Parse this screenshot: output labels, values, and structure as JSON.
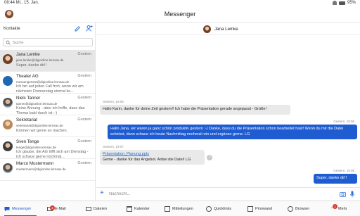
{
  "statusbar": {
    "time": "08:44 Mi., 15. Jan.",
    "battery": "95%"
  },
  "app": {
    "title": "Messenger"
  },
  "contacts_panel": {
    "label": "Kontakte",
    "search_placeholder": "Suche",
    "items": [
      {
        "name": "Jana Lemke",
        "time": "Gestern",
        "email": "jana.lemke@digionline.lernsax.de",
        "preview": "Super, danke dir!!",
        "active": true
      },
      {
        "name": "Theater AG",
        "time": "Gestern",
        "email": "messengertest@digionline.lernsax.de",
        "preview": "Ich bin auf jeden Fall froh, wenn wir am nächsten Donnerstag einmal ko..."
      },
      {
        "name": "Niels Tanner",
        "time": "Gestern",
        "email": "tanner@digionline.lernsax.de",
        "preview": "Keine Ahnung - aber ich hoffe, dass das Thema bald durch ist :-)"
      },
      {
        "name": "Sekretariat",
        "time": "Gestern",
        "email": "sekretariat@digionline.lernsax.de",
        "preview": "Können wir gerne so machen."
      },
      {
        "name": "Sven Tenge",
        "time": "Gestern",
        "email": "tenge@digionline.lernsax.de",
        "preview": "Ich glaube, die AG trifft sich am Dienstag - ich schaue gerne nochmal..."
      },
      {
        "name": "Marco Mustermann",
        "time": "Gestern",
        "email": "mustermann@digionline.lernsax.de",
        "preview": ""
      }
    ]
  },
  "chat": {
    "partner": "Jana Lemke",
    "messages": [
      {
        "direction": "in",
        "time": "Gestern, 19:05",
        "text": "Hallo Karin, danke für deine Zeit gestern!! Ich habe die Präsentation gerade angepasst - Grüße!"
      },
      {
        "direction": "out",
        "time": "Gestern, 19:06",
        "text": "Hallo Jana, wir waren ja ganz schön produktiv gestern :-) Danke, dass du die Präsentation schon bearbeitet hast! Wenn du mir die Datei schickst, dann schaue ich heute Nachmittag nochmal rein und ergänze gerne. LG"
      },
      {
        "direction": "in",
        "time": "Gestern, 19:07",
        "attachment": "Präsentation_Planung.pptx",
        "text": "Geme - danke für das Angebot. Anbei die Datei! LG"
      },
      {
        "direction": "out",
        "time": "Gestern, 19:08",
        "text": "Super, danke dir!!"
      }
    ],
    "input_placeholder": "Nachricht..."
  },
  "bottomnav": [
    {
      "label": "Messenger",
      "active": true
    },
    {
      "label": "E-Mail",
      "badge": "2"
    },
    {
      "label": "Dateien"
    },
    {
      "label": "Kalender"
    },
    {
      "label": "Mitteilungen"
    },
    {
      "label": "Quicklinks"
    },
    {
      "label": "Pinnwand"
    },
    {
      "label": "Browser"
    },
    {
      "label": "Mehr",
      "badge": "1"
    }
  ],
  "colors": {
    "accent": "#1f5bd1",
    "badge": "#d83b2e",
    "outgoing_bubble": "#1f5bd1",
    "incoming_bubble": "#e9e9e9"
  }
}
